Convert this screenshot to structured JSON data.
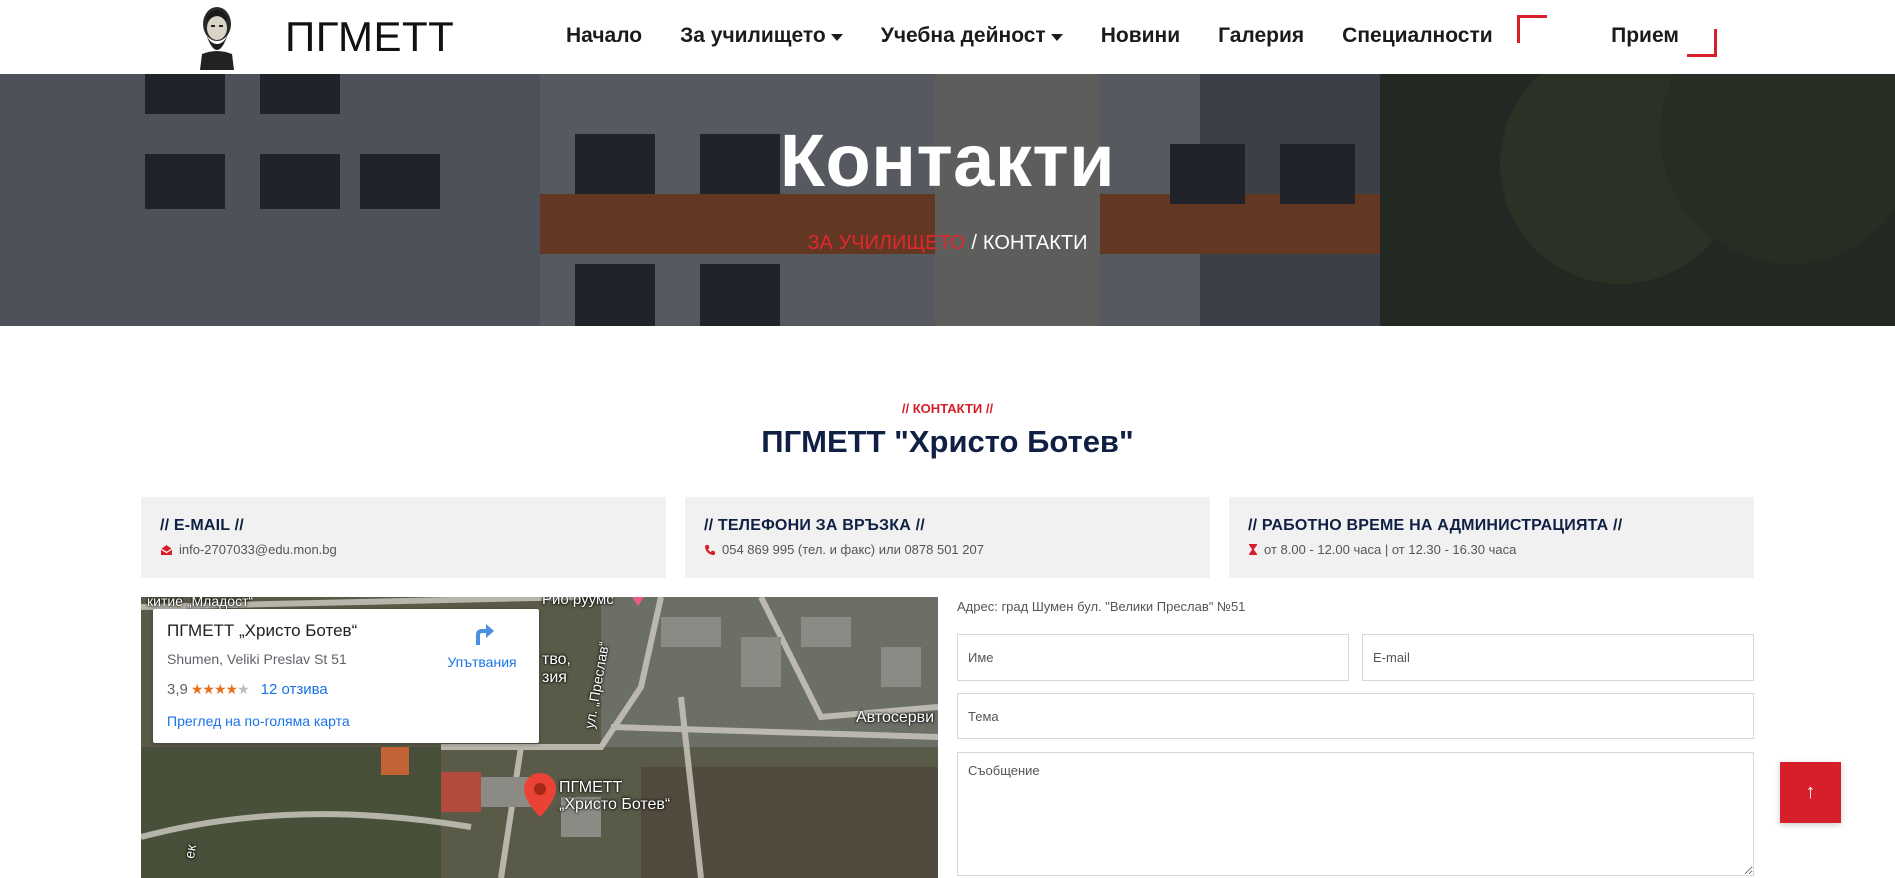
{
  "header": {
    "logo_text": "ПГМЕТТ",
    "nav": [
      {
        "label": "Начало",
        "dropdown": false
      },
      {
        "label": "За училището",
        "dropdown": true
      },
      {
        "label": "Учебна дейност",
        "dropdown": true
      },
      {
        "label": "Новини",
        "dropdown": false
      },
      {
        "label": "Галерия",
        "dropdown": false
      },
      {
        "label": "Специалности",
        "dropdown": false
      }
    ],
    "cta_label": "Прием"
  },
  "hero": {
    "title": "Контакти",
    "breadcrumb_parent": "ЗА УЧИЛИЩЕТО",
    "breadcrumb_separator": "/",
    "breadcrumb_current": "КОНТАКТИ"
  },
  "section": {
    "tag": "// КОНТАКТИ //",
    "title": "ПГМЕТТ \"Христо Ботев\""
  },
  "cards": [
    {
      "heading": "// E-MAIL //",
      "icon": "envelope-icon",
      "text": "info-2707033@edu.mon.bg"
    },
    {
      "heading": "// ТЕЛЕФОНИ ЗА ВРЪЗКА //",
      "icon": "phone-icon",
      "text": "054 869 995 (тел. и факс) или 0878 501 207"
    },
    {
      "heading": "// РАБОТНО ВРЕМЕ НА АДМИНИСТРАЦИЯТА //",
      "icon": "hourglass-icon",
      "text": "от 8.00 - 12.00 часа | от 12.30 - 16.30 часа"
    }
  ],
  "map": {
    "place_name": "ПГМЕТТ „Христо Ботев“",
    "address": "Shumen, Veliki Preslav St 51",
    "rating": "3,9",
    "stars": 4,
    "reviews": "12 отзива",
    "directions": "Упътвания",
    "larger_map": "Преглед на по-голяма карта",
    "labels": {
      "top_left": "китие „Младост“",
      "top_mid": "Рио руумс",
      "mid_left_1": "тво,",
      "mid_left_2": "зия",
      "street": "ул. „Преслав“",
      "right": "Автосерви",
      "pin_1": "ПГМЕТТ",
      "pin_2": "„Христо Ботев“",
      "bottom_left": "ек"
    }
  },
  "form": {
    "address_line": "Адрес: град Шумен бул. \"Велики Преслав\" №51",
    "name_placeholder": "Име",
    "email_placeholder": "E-mail",
    "subject_placeholder": "Тема",
    "message_placeholder": "Съобщение"
  },
  "to_top": "↑",
  "colors": {
    "accent": "#d61f2b",
    "navy": "#0f2044"
  }
}
